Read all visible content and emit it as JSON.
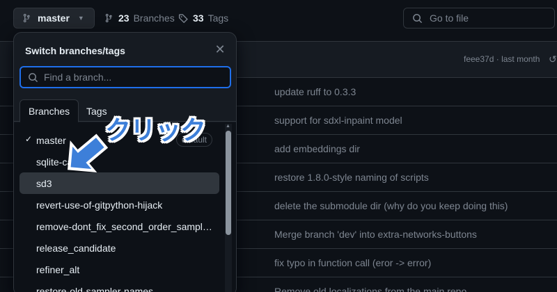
{
  "topbar": {
    "branch": "master",
    "branches_count": "23",
    "branches_label": "Branches",
    "tags_count": "33",
    "tags_label": "Tags",
    "goto_placeholder": "Go to file"
  },
  "latest_commit": {
    "hash": "feee37d",
    "time": "· last month"
  },
  "commits": [
    "update ruff to 0.3.3",
    "support for sdxl-inpaint model",
    "add embeddings dir",
    "restore 1.8.0-style naming of scripts",
    "delete the submodule dir (why do you keep doing this)",
    "Merge branch 'dev' into extra-networks-buttons",
    "fix typo in function call (eror -> error)",
    "Remove old localizations from the main repo"
  ],
  "dropdown": {
    "title": "Switch branches/tags",
    "search_placeholder": "Find a branch...",
    "tabs": [
      "Branches",
      "Tags"
    ],
    "default_badge": "default",
    "branches": [
      "master",
      "sqlite-cache",
      "sd3",
      "revert-use-of-gitpython-hijack",
      "remove-dont_fix_second_order_samplers_schedule",
      "release_candidate",
      "refiner_alt",
      "restore-old-sampler-names"
    ]
  },
  "annotation": {
    "label": "クリック",
    "color": "#3d7fd9"
  },
  "colors": {
    "bg": "#0d1117",
    "panel": "#161b22",
    "border": "#30363d",
    "focus": "#1f6feb",
    "muted": "#7d8590"
  }
}
